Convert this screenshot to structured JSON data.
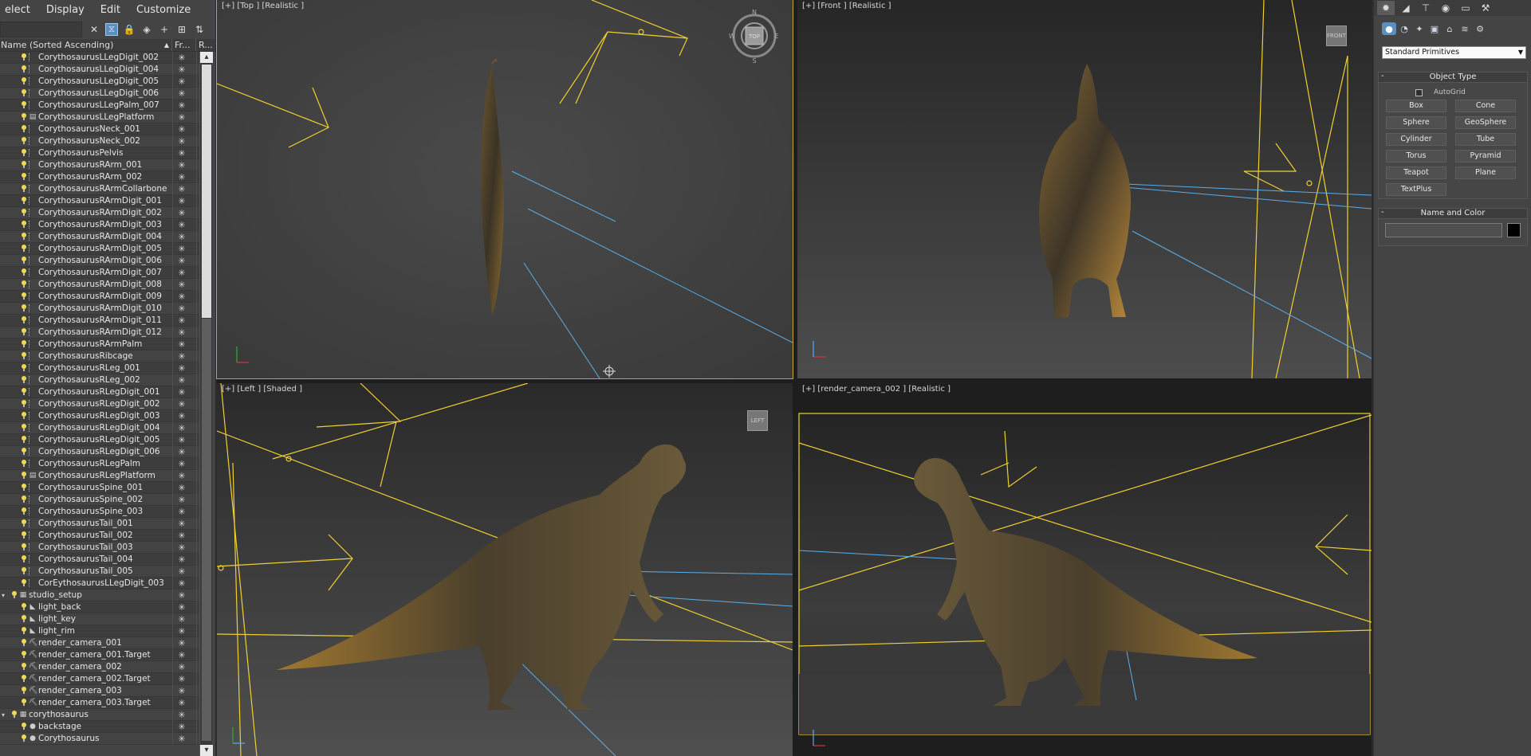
{
  "menu": [
    "elect",
    "Display",
    "Edit",
    "Customize"
  ],
  "columns": {
    "name": "Name (Sorted Ascending)",
    "frozen": "Fr...",
    "render": "R..."
  },
  "tree": [
    {
      "label": "CorythosaurusLLegDigit_002",
      "depth": 3,
      "icon": "bone"
    },
    {
      "label": "CorythosaurusLLegDigit_004",
      "depth": 3,
      "icon": "bone"
    },
    {
      "label": "CorythosaurusLLegDigit_005",
      "depth": 3,
      "icon": "bone"
    },
    {
      "label": "CorythosaurusLLegDigit_006",
      "depth": 3,
      "icon": "bone"
    },
    {
      "label": "CorythosaurusLLegPalm_007",
      "depth": 3,
      "icon": "bone"
    },
    {
      "label": "CorythosaurusLLegPlatform",
      "depth": 3,
      "icon": "platform"
    },
    {
      "label": "CorythosaurusNeck_001",
      "depth": 3,
      "icon": "bone"
    },
    {
      "label": "CorythosaurusNeck_002",
      "depth": 3,
      "icon": "bone"
    },
    {
      "label": "CorythosaurusPelvis",
      "depth": 3,
      "icon": "bone"
    },
    {
      "label": "CorythosaurusRArm_001",
      "depth": 3,
      "icon": "bone"
    },
    {
      "label": "CorythosaurusRArm_002",
      "depth": 3,
      "icon": "bone"
    },
    {
      "label": "CorythosaurusRArmCollarbone",
      "depth": 3,
      "icon": "bone"
    },
    {
      "label": "CorythosaurusRArmDigit_001",
      "depth": 3,
      "icon": "bone"
    },
    {
      "label": "CorythosaurusRArmDigit_002",
      "depth": 3,
      "icon": "bone"
    },
    {
      "label": "CorythosaurusRArmDigit_003",
      "depth": 3,
      "icon": "bone"
    },
    {
      "label": "CorythosaurusRArmDigit_004",
      "depth": 3,
      "icon": "bone"
    },
    {
      "label": "CorythosaurusRArmDigit_005",
      "depth": 3,
      "icon": "bone"
    },
    {
      "label": "CorythosaurusRArmDigit_006",
      "depth": 3,
      "icon": "bone"
    },
    {
      "label": "CorythosaurusRArmDigit_007",
      "depth": 3,
      "icon": "bone"
    },
    {
      "label": "CorythosaurusRArmDigit_008",
      "depth": 3,
      "icon": "bone"
    },
    {
      "label": "CorythosaurusRArmDigit_009",
      "depth": 3,
      "icon": "bone"
    },
    {
      "label": "CorythosaurusRArmDigit_010",
      "depth": 3,
      "icon": "bone"
    },
    {
      "label": "CorythosaurusRArmDigit_011",
      "depth": 3,
      "icon": "bone"
    },
    {
      "label": "CorythosaurusRArmDigit_012",
      "depth": 3,
      "icon": "bone"
    },
    {
      "label": "CorythosaurusRArmPalm",
      "depth": 3,
      "icon": "bone"
    },
    {
      "label": "CorythosaurusRibcage",
      "depth": 3,
      "icon": "bone"
    },
    {
      "label": "CorythosaurusRLeg_001",
      "depth": 3,
      "icon": "bone"
    },
    {
      "label": "CorythosaurusRLeg_002",
      "depth": 3,
      "icon": "bone"
    },
    {
      "label": "CorythosaurusRLegDigit_001",
      "depth": 3,
      "icon": "bone"
    },
    {
      "label": "CorythosaurusRLegDigit_002",
      "depth": 3,
      "icon": "bone"
    },
    {
      "label": "CorythosaurusRLegDigit_003",
      "depth": 3,
      "icon": "bone"
    },
    {
      "label": "CorythosaurusRLegDigit_004",
      "depth": 3,
      "icon": "bone"
    },
    {
      "label": "CorythosaurusRLegDigit_005",
      "depth": 3,
      "icon": "bone"
    },
    {
      "label": "CorythosaurusRLegDigit_006",
      "depth": 3,
      "icon": "bone"
    },
    {
      "label": "CorythosaurusRLegPalm",
      "depth": 3,
      "icon": "bone"
    },
    {
      "label": "CorythosaurusRLegPlatform",
      "depth": 3,
      "icon": "platform"
    },
    {
      "label": "CorythosaurusSpine_001",
      "depth": 3,
      "icon": "bone"
    },
    {
      "label": "CorythosaurusSpine_002",
      "depth": 3,
      "icon": "bone"
    },
    {
      "label": "CorythosaurusSpine_003",
      "depth": 3,
      "icon": "bone"
    },
    {
      "label": "CorythosaurusTail_001",
      "depth": 3,
      "icon": "bone"
    },
    {
      "label": "CorythosaurusTail_002",
      "depth": 3,
      "icon": "bone"
    },
    {
      "label": "CorythosaurusTail_003",
      "depth": 3,
      "icon": "bone"
    },
    {
      "label": "CorythosaurusTail_004",
      "depth": 3,
      "icon": "bone"
    },
    {
      "label": "CorythosaurusTail_005",
      "depth": 3,
      "icon": "bone"
    },
    {
      "label": "CorEythosaurusLLegDigit_003",
      "depth": 3,
      "icon": "bone"
    },
    {
      "label": "studio_setup",
      "depth": 1,
      "icon": "layer",
      "expander": "▾"
    },
    {
      "label": "light_back",
      "depth": 2,
      "icon": "light"
    },
    {
      "label": "light_key",
      "depth": 2,
      "icon": "light"
    },
    {
      "label": "light_rim",
      "depth": 2,
      "icon": "light"
    },
    {
      "label": "render_camera_001",
      "depth": 2,
      "icon": "camera"
    },
    {
      "label": "render_camera_001.Target",
      "depth": 2,
      "icon": "camera"
    },
    {
      "label": "render_camera_002",
      "depth": 2,
      "icon": "camera"
    },
    {
      "label": "render_camera_002.Target",
      "depth": 2,
      "icon": "camera"
    },
    {
      "label": "render_camera_003",
      "depth": 2,
      "icon": "camera"
    },
    {
      "label": "render_camera_003.Target",
      "depth": 2,
      "icon": "camera"
    },
    {
      "label": "corythosaurus",
      "depth": 1,
      "icon": "layer",
      "expander": "▾"
    },
    {
      "label": "backstage",
      "depth": 2,
      "icon": "sphere"
    },
    {
      "label": "Corythosaurus",
      "depth": 2,
      "icon": "sphere"
    }
  ],
  "viewports": {
    "top": "[+] [Top ] [Realistic ]",
    "front": "[+] [Front ] [Realistic ]",
    "left": "[+] [Left ] [Shaded ]",
    "camera": "[+] [render_camera_002 ] [Realistic ]"
  },
  "compass": {
    "n": "N",
    "s": "S",
    "e": "E",
    "w": "W",
    "cube": "TOP"
  },
  "viewcube_front": "FRONT",
  "viewcube_left": "LEFT",
  "command_panel": {
    "dropdown": "Standard Primitives",
    "object_type_title": "Object Type",
    "autogrid": "AutoGrid",
    "buttons": [
      "Box",
      "Cone",
      "Sphere",
      "GeoSphere",
      "Cylinder",
      "Tube",
      "Torus",
      "Pyramid",
      "Teapot",
      "Plane",
      "TextPlus"
    ],
    "name_color_title": "Name and Color",
    "minus": "-"
  },
  "colors": {
    "selection_yellow": "#f2d84c",
    "light_blue": "#5aaee8",
    "active_border": "#c8a52e"
  }
}
